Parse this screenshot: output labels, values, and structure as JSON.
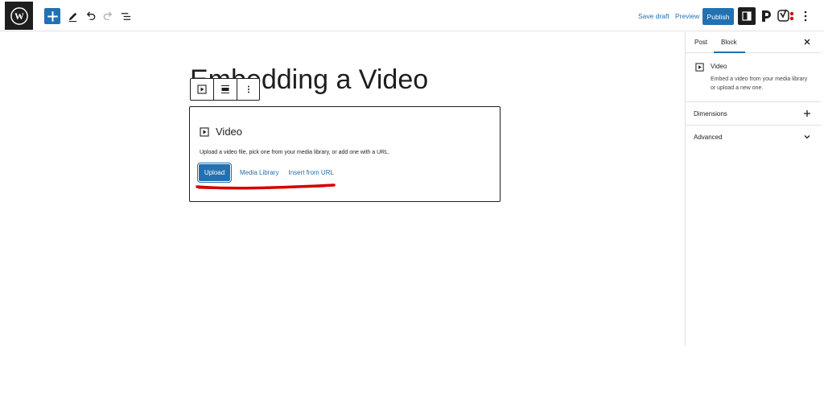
{
  "topbar": {
    "wp_logo_icon": "wordpress-logo-icon",
    "add_block_icon": "plus-icon",
    "tools_icon": "pencil-icon",
    "undo_icon": "undo-icon",
    "redo_icon": "redo-icon",
    "list_view_icon": "list-view-icon",
    "save_draft_label": "Save draft",
    "preview_label": "Preview",
    "publish_label": "Publish",
    "settings_icon": "sidebar-toggle-icon",
    "plugin_icon": "plugin-p-icon",
    "yoast_icon": "yoast-icon",
    "options_icon": "kebab-vertical-icon"
  },
  "editor": {
    "post_title": "Embedding a Video",
    "block_toolbar": {
      "video_icon": "video-icon",
      "align_icon": "align-icon",
      "more_icon": "kebab-vertical-icon"
    },
    "video_placeholder": {
      "title": "Video",
      "description": "Upload a video file, pick one from your media library, or add one with a URL.",
      "upload_label": "Upload",
      "media_library_label": "Media Library",
      "insert_url_label": "Insert from URL"
    }
  },
  "sidebar": {
    "tabs": [
      {
        "label": "Post",
        "active": false
      },
      {
        "label": "Block",
        "active": true
      }
    ],
    "block_card": {
      "name": "Video",
      "description": "Embed a video from your media library or upload a new one."
    },
    "panels": [
      {
        "label": "Dimensions",
        "icon": "plus-icon"
      },
      {
        "label": "Advanced",
        "icon": "chevron-down-icon"
      }
    ]
  },
  "colors": {
    "accent": "#2271b1",
    "dark": "#1e1e1e",
    "annotation": "#d40000"
  }
}
